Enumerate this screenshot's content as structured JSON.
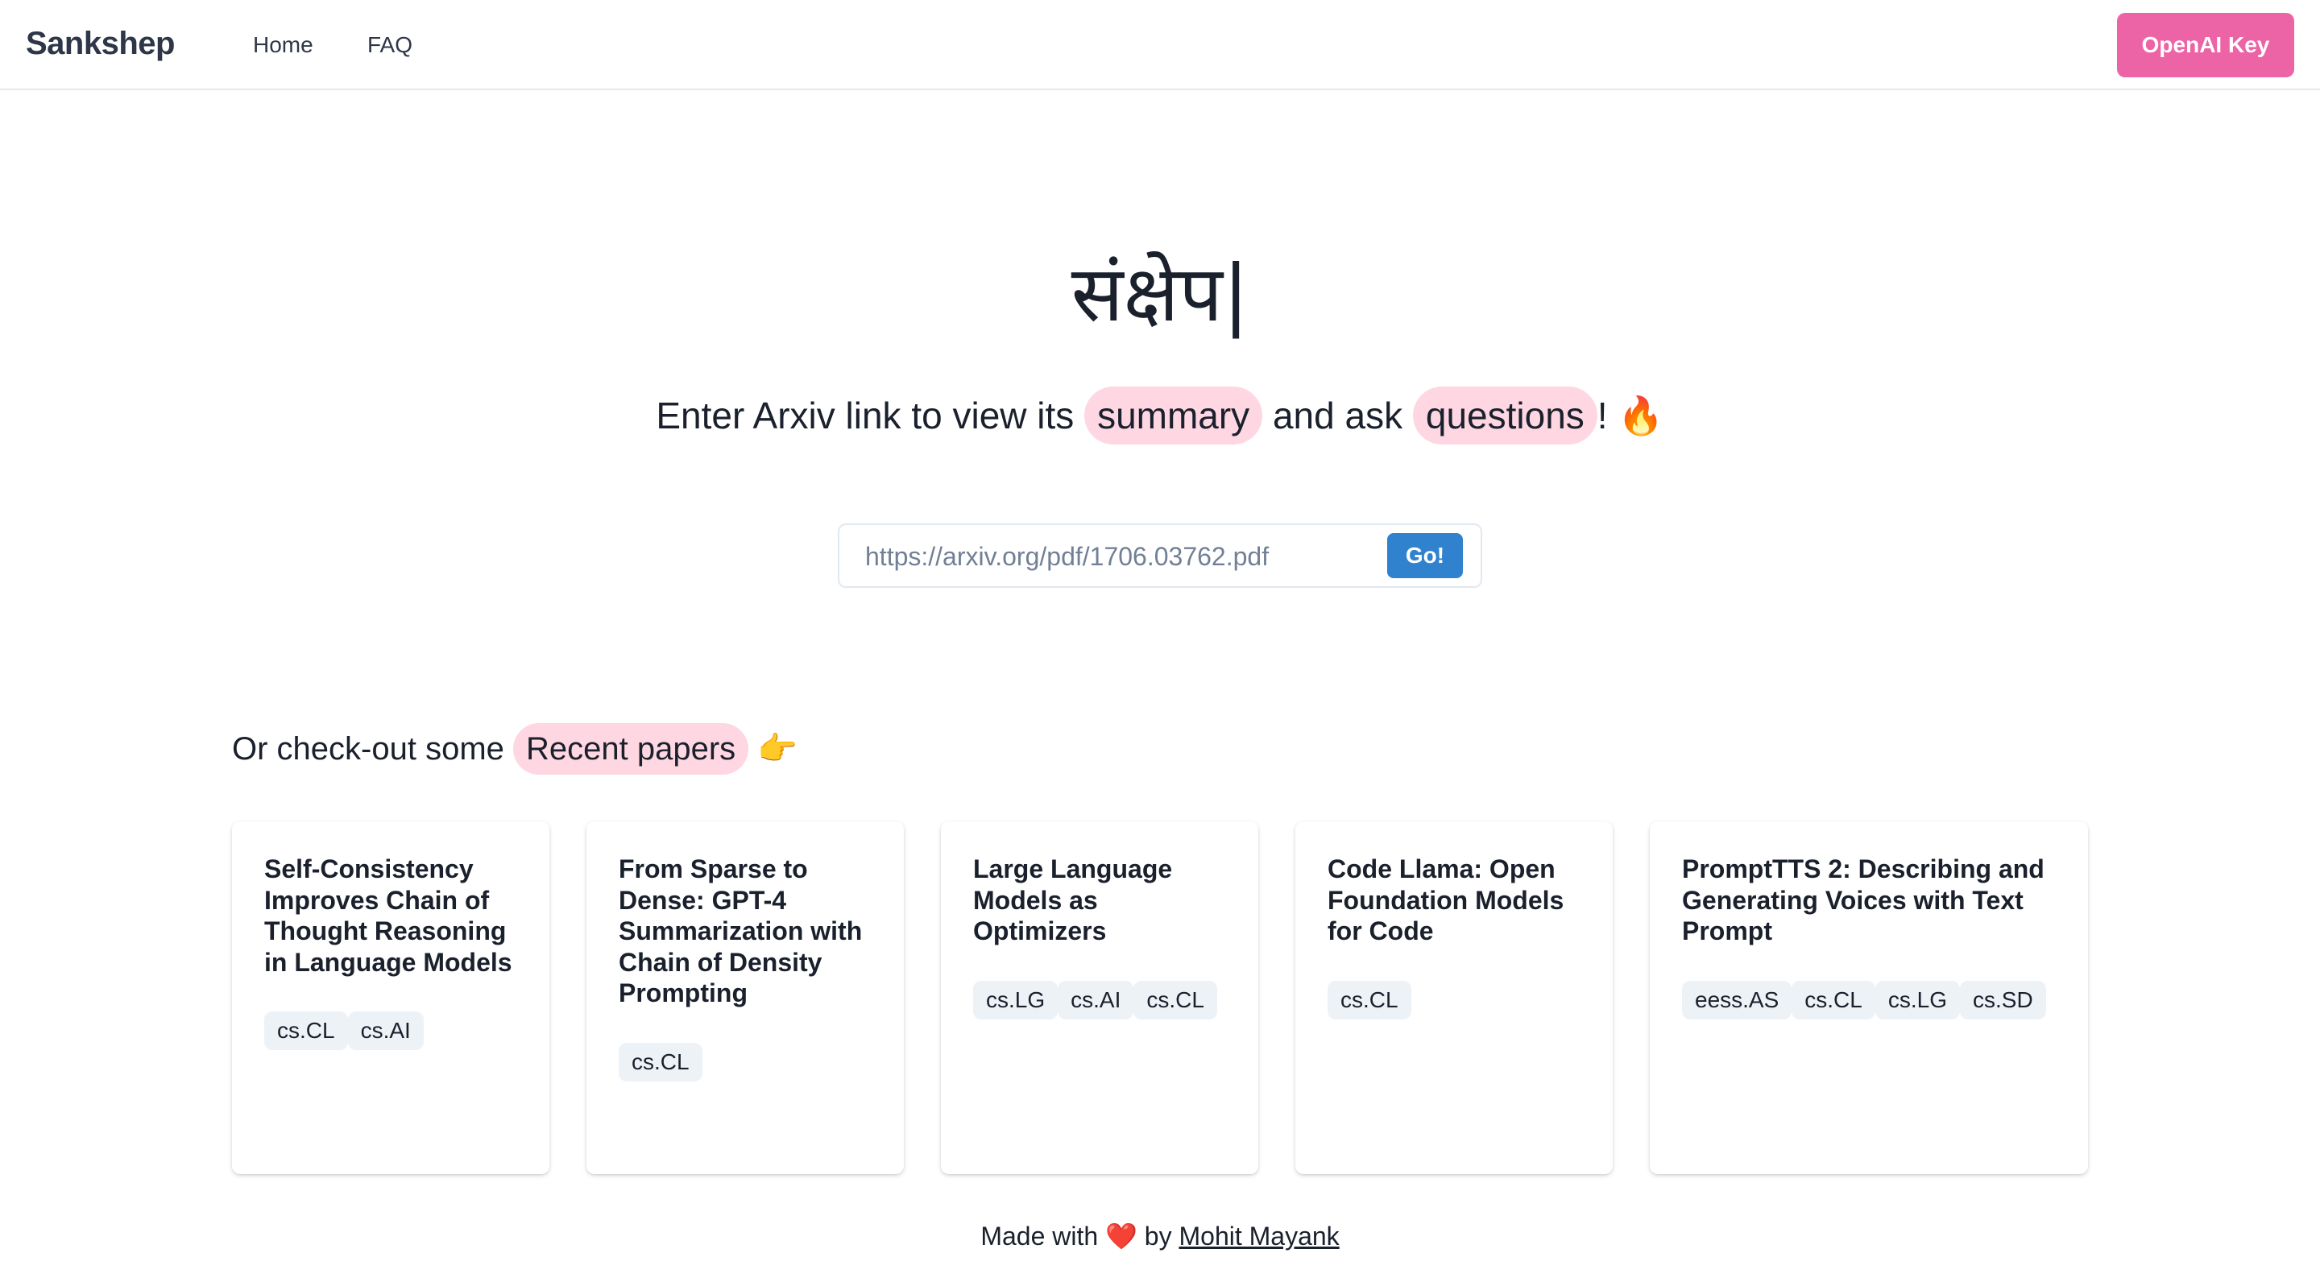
{
  "navbar": {
    "brand": "Sankshep",
    "links": [
      "Home",
      "FAQ"
    ],
    "key_button": "OpenAI Key",
    "accent": "#ed64a6"
  },
  "hero": {
    "title": "संक्षेप",
    "caret": "|",
    "subtitle_prefix": "Enter Arxiv link to view its",
    "highlight_1": "summary",
    "subtitle_middle": "and ask",
    "highlight_2": "questions",
    "subtitle_suffix": "!",
    "fire_emoji": "🔥",
    "highlight_color": "#fed7e2"
  },
  "search": {
    "placeholder": "https://arxiv.org/pdf/1706.03762.pdf",
    "value": "",
    "button": "Go!",
    "button_color": "#3182ce"
  },
  "recent": {
    "prefix": "Or check-out some",
    "highlight": "Recent papers",
    "pointing_emoji": "👉"
  },
  "papers": [
    {
      "title": "Self-Consistency Improves Chain of Thought Reasoning in Language Models",
      "tags": [
        "cs.CL",
        "cs.AI"
      ]
    },
    {
      "title": "From Sparse to Dense: GPT-4 Summarization with Chain of Density Prompting",
      "tags": [
        "cs.CL"
      ]
    },
    {
      "title": "Large Language Models as Optimizers",
      "tags": [
        "cs.LG",
        "cs.AI",
        "cs.CL"
      ]
    },
    {
      "title": "Code Llama: Open Foundation Models for Code",
      "tags": [
        "cs.CL"
      ]
    },
    {
      "title": "PromptTTS 2: Describing and Generating Voices with Text Prompt",
      "tags": [
        "eess.AS",
        "cs.CL",
        "cs.LG",
        "cs.SD"
      ]
    }
  ],
  "footer": {
    "prefix": "Made with",
    "heart": "❤️",
    "by": "by",
    "author": "Mohit Mayank"
  }
}
